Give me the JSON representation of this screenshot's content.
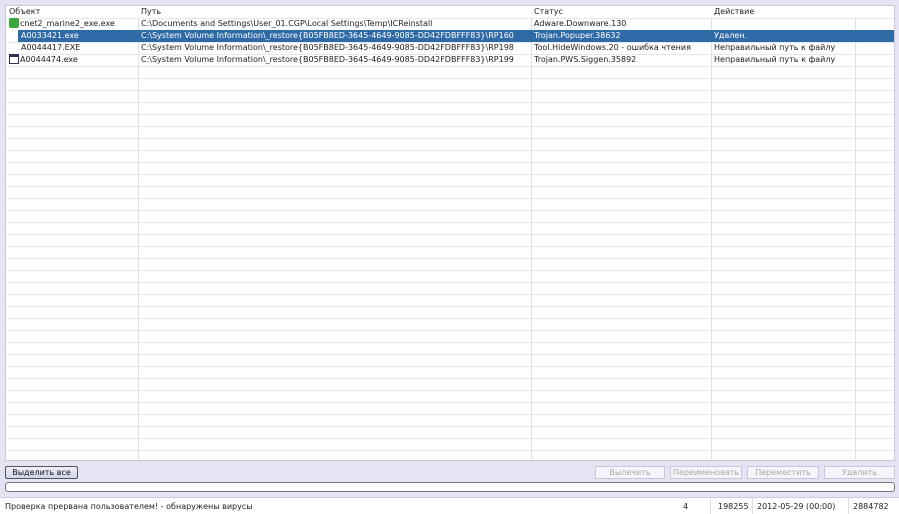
{
  "table": {
    "headers": [
      "Объект",
      "Путь",
      "Статус",
      "Действие"
    ],
    "rows": [
      {
        "object": "cnet2_marine2_exe.exe",
        "path": "C:\\Documents and Settings\\User_01.CGP\\Local Settings\\Temp\\ICReinstall",
        "status": "Adware.Downware.130",
        "action": "",
        "icon": "shield-check-icon"
      },
      {
        "object": "A0033421.exe",
        "path": "C:\\System Volume Information\\_restore{B05FB8ED-3645-4649-9085-DD42FDBFFF83}\\RP160",
        "status": "Trojan.Popuper.38632",
        "action": "Удален.",
        "selected": true
      },
      {
        "object": "A0044417.EXE",
        "path": "C:\\System Volume Information\\_restore{B05FB8ED-3645-4649-9085-DD42FDBFFF83}\\RP198",
        "status": "Tool.HideWindows.20 - ошибка чтения",
        "action": "Неправильный путь к файлу"
      },
      {
        "object": "A0044474.exe",
        "path": "C:\\System Volume Information\\_restore{B05FB8ED-3645-4649-9085-DD42FDBFFF83}\\RP199",
        "status": "Trojan.PWS.Siggen.35892",
        "action": "Неправильный путь к файлу",
        "icon": "window-icon"
      }
    ]
  },
  "buttons": {
    "select_all": "Выделить все",
    "cure": "Вылечить",
    "rename": "Переименовать",
    "move": "Переместить",
    "delete": "Удалить"
  },
  "progress": {
    "value": 0
  },
  "status": {
    "message": "Проверка прервана пользователем! - обнаружены вирусы",
    "count": "4",
    "files": "198255",
    "date": "2012-05-29 (00:00)",
    "records": "2884782"
  }
}
